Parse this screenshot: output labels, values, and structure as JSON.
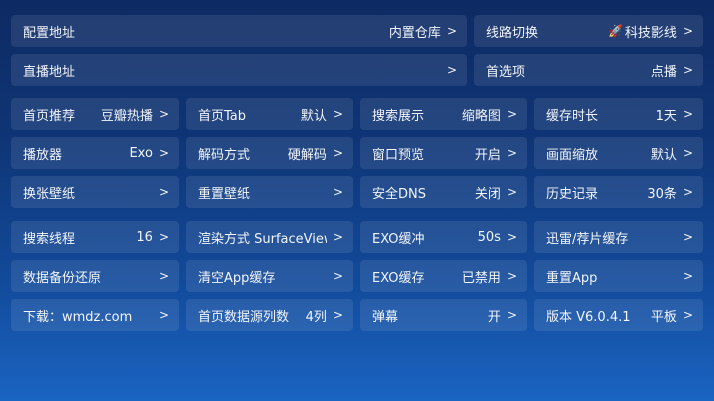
{
  "top": [
    {
      "label": "配置地址",
      "value": "内置仓库",
      "chev": ">"
    },
    {
      "label": "线路切换",
      "value": "科技影线",
      "chev": ">",
      "icon": "rocket-icon"
    },
    {
      "label": "直播地址",
      "value": "",
      "chev": ">"
    },
    {
      "label": "首选项",
      "value": "点播",
      "chev": ">"
    }
  ],
  "grid": [
    [
      {
        "label": "首页推荐",
        "value": "豆瓣热播",
        "chev": ">"
      },
      {
        "label": "首页Tab",
        "value": "默认",
        "chev": ">"
      },
      {
        "label": "搜索展示",
        "value": "缩略图",
        "chev": ">"
      },
      {
        "label": "缓存时长",
        "value": "1天",
        "chev": ">"
      }
    ],
    [
      {
        "label": "播放器",
        "value": "Exo",
        "chev": ">"
      },
      {
        "label": "解码方式",
        "value": "硬解码",
        "chev": ">"
      },
      {
        "label": "窗口预览",
        "value": "开启",
        "chev": ">"
      },
      {
        "label": "画面缩放",
        "value": "默认",
        "chev": ">"
      }
    ],
    [
      {
        "label": "换张壁纸",
        "value": "",
        "chev": ">"
      },
      {
        "label": "重置壁纸",
        "value": "",
        "chev": ">"
      },
      {
        "label": "安全DNS",
        "value": "关闭",
        "chev": ">"
      },
      {
        "label": "历史记录",
        "value": "30条",
        "chev": ">"
      }
    ],
    [
      {
        "label": "搜索线程",
        "value": "16",
        "chev": ">"
      },
      {
        "label": "渲染方式 SurfaceView",
        "value": "",
        "chev": ">"
      },
      {
        "label": "EXO缓冲",
        "value": "50s",
        "chev": ">"
      },
      {
        "label": "迅雷/荐片缓存",
        "value": "",
        "chev": ">"
      }
    ],
    [
      {
        "label": "数据备份还原",
        "value": "",
        "chev": ">"
      },
      {
        "label": "清空App缓存",
        "value": "",
        "chev": ">"
      },
      {
        "label": "EXO缓存",
        "value": "已禁用",
        "chev": ">"
      },
      {
        "label": "重置App",
        "value": "",
        "chev": ">"
      }
    ],
    [
      {
        "label": "下载：wmdz.com",
        "value": "",
        "chev": ">"
      },
      {
        "label": "首页数据源列数",
        "value": "4列",
        "chev": ">"
      },
      {
        "label": "弹幕",
        "value": "开",
        "chev": ">"
      },
      {
        "label": "版本 V6.0.4.1",
        "value": "平板",
        "chev": ">"
      }
    ]
  ]
}
